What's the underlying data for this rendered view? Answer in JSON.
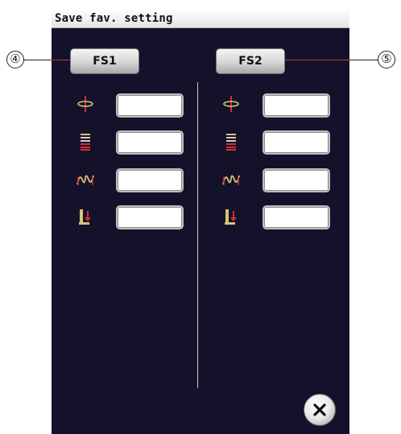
{
  "window": {
    "title": "Save fav. setting"
  },
  "buttons": {
    "fs1": "FS1",
    "fs2": "FS2"
  },
  "callouts": {
    "left": "④",
    "right": "⑤"
  },
  "rows": [
    {
      "icon": "thread-tension-icon",
      "left_value": "",
      "right_value": ""
    },
    {
      "icon": "stitch-length-icon",
      "left_value": "",
      "right_value": ""
    },
    {
      "icon": "stitch-width-icon",
      "left_value": "",
      "right_value": ""
    },
    {
      "icon": "presser-foot-pressure-icon",
      "left_value": "",
      "right_value": ""
    }
  ],
  "close_icon": "close-icon",
  "colors": {
    "screen_bg": "#14122a",
    "accent_red": "#d32f2f",
    "icon_gold": "#d8c27a"
  }
}
